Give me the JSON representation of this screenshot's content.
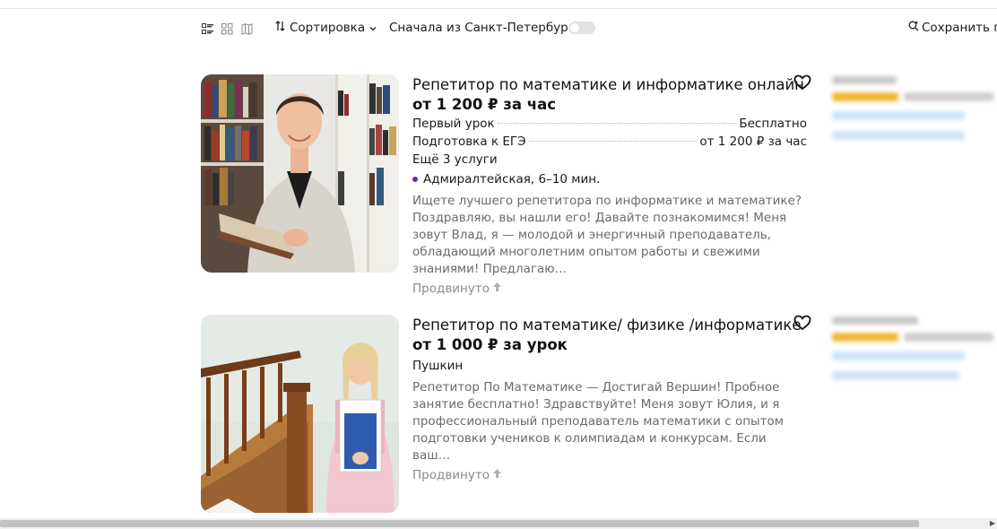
{
  "toolbar": {
    "sort_label": "Сортировка",
    "spb_label": "Сначала из Санкт-Петербурга",
    "spb_toggle_on": false,
    "save_label": "Сохранить по"
  },
  "listings": [
    {
      "title": "Репетитор по математике и информатике онлайн",
      "price": "от 1 200 ₽ за час",
      "services": [
        {
          "name": "Первый урок",
          "value": "Бесплатно"
        },
        {
          "name": "Подготовка к ЕГЭ",
          "value": "от 1 200 ₽ за час"
        }
      ],
      "more_services": "Ещё 3 услуги",
      "metro": "Адмиралтейская, 6–10 мин.",
      "description": "Ищете лучшего репетитора по информатике и математике? Поздравляю, вы нашли его! Давайте познакомимся! Меня зовут Влад, я — молодой и энергичный преподаватель, обладающий многолетним опытом работы и свежими знаниями! Предлагаю…",
      "promoted": "Продвинуто",
      "accent_color": "#6b2aa8"
    },
    {
      "title": "Репетитор по математике/ физике /информатике",
      "price": "от 1 000 ₽ за урок",
      "place": "Пушкин",
      "description": "Репетитор По Математике — Достигай Вершин! Пробное занятие бесплатно! Здравствуйте! Меня зовут Юлия, и я профессиональный преподаватель математики с опытом подготовки учеников к олимпиадам и конкурсам. Если ваш…",
      "promoted": "Продвинуто"
    }
  ]
}
